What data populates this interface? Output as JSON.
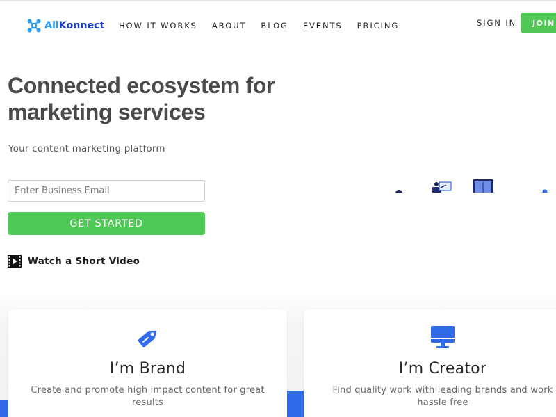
{
  "brand": {
    "logo_part1": "All",
    "logo_part2": "Konnect",
    "icon": "molecule-logo-icon",
    "colors": {
      "primary_blue": "#2f6be8",
      "light_blue": "#2d9bf0",
      "green": "#4fc955"
    }
  },
  "nav": {
    "items": [
      {
        "label": "HOW IT WORKS"
      },
      {
        "label": "ABOUT"
      },
      {
        "label": "BLOG"
      },
      {
        "label": "EVENTS"
      },
      {
        "label": "PRICING"
      }
    ],
    "sign_in": "SIGN IN",
    "join": "JOIN"
  },
  "hero": {
    "title": "Connected ecosystem for marketing services",
    "subtitle": "Your content marketing platform",
    "email_placeholder": "Enter Business Email",
    "email_value": "",
    "cta": "GET STARTED",
    "video_label": "Watch a Short Video",
    "video_icon": "film-play-icon"
  },
  "cards": [
    {
      "icon": "price-tag-icon",
      "title": "I’m Brand",
      "description": "Create and promote high impact content for great results"
    },
    {
      "icon": "monitor-icon",
      "title": "I’m Creator",
      "description": "Find quality work with leading brands and work hassle free"
    }
  ]
}
